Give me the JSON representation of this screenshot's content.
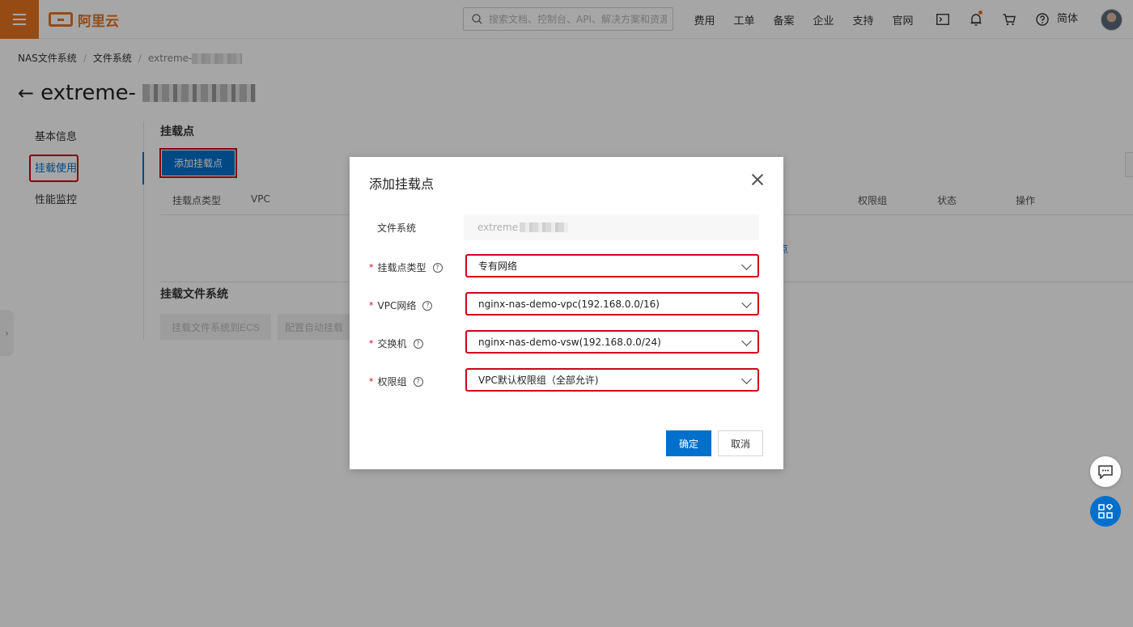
{
  "header": {
    "logo_text": "阿里云",
    "search_placeholder": "搜索文档、控制台、API、解决方案和资源",
    "nav": [
      "费用",
      "工单",
      "备案",
      "企业",
      "支持",
      "官网"
    ],
    "lang": "简体"
  },
  "breadcrumb": {
    "items": [
      "NAS文件系统",
      "文件系统"
    ],
    "current": "extreme-"
  },
  "page_title": "extreme-",
  "sidebar": {
    "items": [
      {
        "label": "基本信息"
      },
      {
        "label": "挂载使用"
      },
      {
        "label": "性能监控"
      }
    ]
  },
  "mount_section": {
    "title": "挂载点",
    "add_button": "添加挂载点",
    "columns": [
      "挂载点类型",
      "VPC",
      "权限组",
      "状态",
      "操作"
    ],
    "empty_link_tail": "点"
  },
  "mount_fs_section": {
    "title": "挂载文件系统",
    "buttons": [
      "挂载文件系统到ECS",
      "配置自动挂载"
    ]
  },
  "dialog": {
    "title": "添加挂载点",
    "fields": {
      "file_system": {
        "label": "文件系统",
        "value": "extreme"
      },
      "mount_type": {
        "label": "挂载点类型",
        "value": "专有网络"
      },
      "vpc": {
        "label": "VPC网络",
        "value": "nginx-nas-demo-vpc(192.168.0.0/16)"
      },
      "vswitch": {
        "label": "交换机",
        "value": "nginx-nas-demo-vsw(192.168.0.0/24)"
      },
      "permission_group": {
        "label": "权限组",
        "value": "VPC默认权限组（全部允许)"
      }
    },
    "ok": "确定",
    "cancel": "取消"
  },
  "colors": {
    "brand": "#e8731f",
    "primary": "#0070cc",
    "highlight": "#d0021b"
  }
}
